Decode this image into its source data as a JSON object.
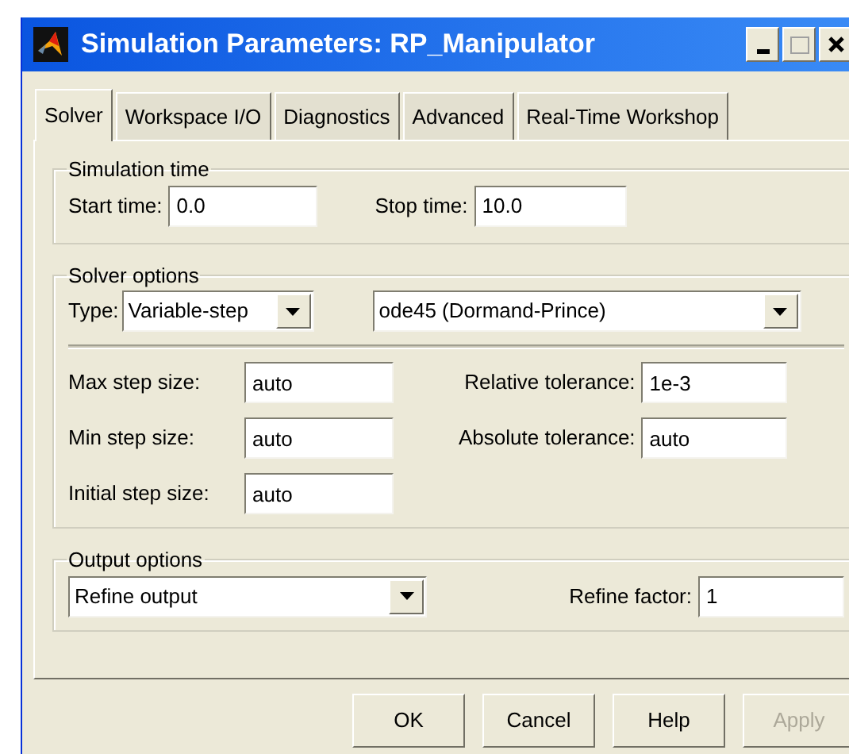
{
  "window": {
    "title": "Simulation Parameters: RP_Manipulator"
  },
  "tabs": [
    {
      "label": "Solver",
      "selected": true
    },
    {
      "label": "Workspace I/O",
      "selected": false
    },
    {
      "label": "Diagnostics",
      "selected": false
    },
    {
      "label": "Advanced",
      "selected": false
    },
    {
      "label": "Real-Time Workshop",
      "selected": false
    }
  ],
  "simulation_time": {
    "title": "Simulation time",
    "fields": [
      {
        "label": "Start time:",
        "value": "0.0"
      },
      {
        "label": "Stop time:",
        "value": "10.0"
      }
    ]
  },
  "solver_options": {
    "title": "Solver options",
    "type_label": "Type:",
    "type_value": "Variable-step",
    "solver_value": "ode45 (Dormand-Prince)",
    "left_fields": [
      {
        "label": "Max step size:",
        "value": "auto"
      },
      {
        "label": "Min step size:",
        "value": "auto"
      },
      {
        "label": "Initial step size:",
        "value": "auto"
      }
    ],
    "right_fields": [
      {
        "label": "Relative tolerance:",
        "value": "1e-3"
      },
      {
        "label": "Absolute tolerance:",
        "value": "auto"
      }
    ]
  },
  "output_options": {
    "title": "Output options",
    "option_value": "Refine output",
    "field": {
      "label": "Refine factor:",
      "value": "1"
    }
  },
  "buttons": [
    {
      "label": "OK",
      "disabled": false
    },
    {
      "label": "Cancel",
      "disabled": false
    },
    {
      "label": "Help",
      "disabled": false
    },
    {
      "label": "Apply",
      "disabled": true
    }
  ]
}
